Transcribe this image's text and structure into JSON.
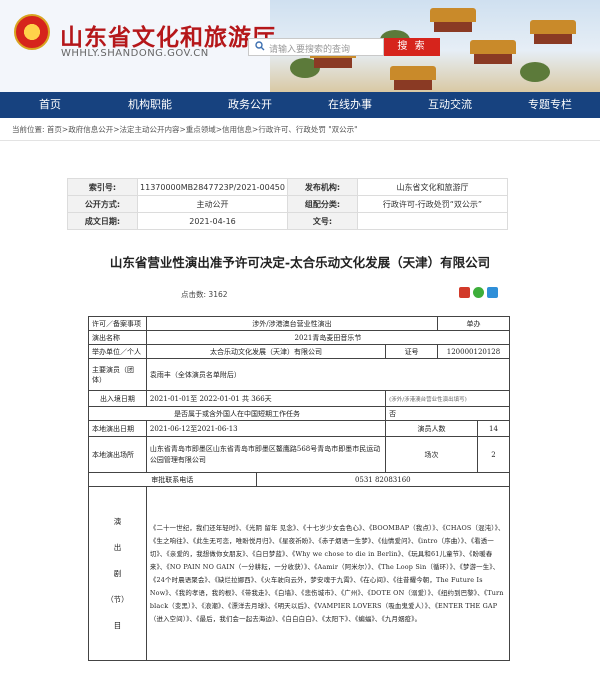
{
  "header": {
    "title": "山东省文化和旅游厅",
    "url": "WHHLY.SHANDONG.GOV.CN",
    "search_placeholder": "请输入要搜索的查询",
    "search_button": "搜 索"
  },
  "nav": [
    "首页",
    "机构职能",
    "政务公开",
    "在线办事",
    "互动交流",
    "专题专栏"
  ],
  "breadcrumb": "当前位置: 首页>政府信息公开>法定主动公开内容>重点领域>信用信息>行政许可、行政处罚 \"双公示\"",
  "meta": {
    "index_label": "索引号:",
    "index": "11370000MB2847723P/2021-00450",
    "org_label": "发布机构:",
    "org": "山东省文化和旅游厅",
    "open_label": "公开方式:",
    "open": "主动公开",
    "cat_label": "组配分类:",
    "cat": "行政许可-行政处罚“双公示”",
    "date_label": "成文日期:",
    "date": "2021-04-16",
    "docno_label": "文号:",
    "docno": ""
  },
  "doc_title": "山东省营业性演出准予许可决定-太合乐动文化发展（天津）有限公司",
  "views_label": "点击数:",
  "views": "3162",
  "form": {
    "r1": [
      "许可／备案事项",
      "涉外/涉港澳台营业性演出",
      "单办"
    ],
    "r2": [
      "演出名称",
      "2021青岛麦田音乐节"
    ],
    "r3": [
      "举办单位／个人",
      "太合乐动文化发展（天津）有限公司",
      "证号",
      "120000120128"
    ],
    "r4": [
      "主要演员（团体）",
      "袁雨丰（全体演员名单附后）"
    ],
    "r5": [
      "出入境日期",
      "2021-01-01至 2022-01-01  共 366天",
      "(涉外/涉港澳台营业性演出填写)"
    ],
    "r6": [
      "是否属于或含外国人在中国短期工作任务",
      "否"
    ],
    "r7": [
      "本地演出日期",
      "2021-06-12至2021-06-13",
      "演员人数",
      "14"
    ],
    "r8": [
      "本地演出场所",
      "山东省青岛市即墨区山东省青岛市即墨区鳌鹰路568号青岛市即墨市民运动公园管理有限公司",
      "场次",
      "2"
    ],
    "r9": [
      "审批联系电话",
      "0531 82083160"
    ],
    "rep_label": [
      "演",
      "出",
      "剧",
      "（节）",
      "目"
    ],
    "repertoire": "《二十一世纪，我们还年轻时》、《光阴 留年 见念》、《十七岁少女会色心》、《BOOMBAP（我点）》、《CHAOS（混沌）》、《生之响往》、《此生无可恋，唯盼悦月归》、《星夜祈盼》、《赤子烟语一生梦》、《仙情爱问》、《intro（序曲）》、《看透一切》、《亲爱的，我想做你女朋友》、《白日梦蓝》、《Why we chose to die in Berlin》、《玩具和61儿童节》、《盼暖春来》、《NO PAIN NO GAIN（一分耕耘，一分收获）》、《Aamir（阿米尔）》、《The Loop Sin（循环）》、《梦游一生》、《24个时晨语聚会》、《缺烂拉娜西》、《火车驶向云外，梦安魂于九霄》、《在心间》、《往昔耀今朝，The Future Is Now》、《我的孝语，我的根》、《带我走》、《白墙》、《悲伤城市》、《广州》、《DOTE ON（溺爱）》、《纽约到巴黎》、《Turn black（变黑）》、《浪潮》、《漂洋去月球》、《明天以后》、《VAMPIER LOVERS（吸血鬼爱人）》、《ENTER THE GAP（进入空间）》、《最后，我们会一起去海边》、《白白白白》、《太阳下》、《蝙蝠》、《九月姻疫》。"
  }
}
